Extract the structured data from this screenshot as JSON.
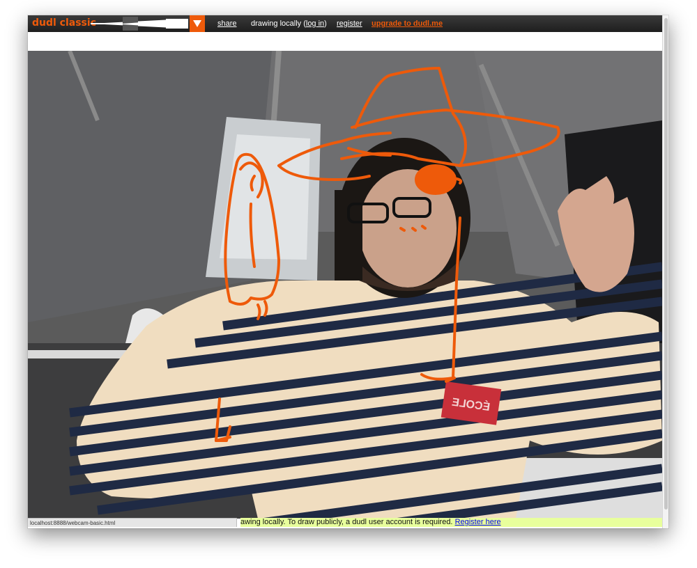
{
  "app": {
    "logo": "dudl classic",
    "accent_color": "#ee5a0a"
  },
  "toolbar": {
    "brush_slider_icon": "brush-size-slider",
    "dropdown_icon": "triangle-down-icon",
    "share_label": "share",
    "status_prefix": "drawing locally (",
    "login_label": "log in",
    "status_suffix": ")",
    "register_label": "register",
    "upgrade_label": "upgrade to dudl.me"
  },
  "canvas": {
    "drawing_color": "#ee5a0a",
    "badge_text": "ÉCOLE"
  },
  "statusbar": {
    "url": "localhost:8888/webcam-basic.html"
  },
  "notice": {
    "text": "awing locally. To draw publicly, a dudl user account is required. ",
    "link_label": "Register here",
    "background": "#e8ff9c"
  }
}
